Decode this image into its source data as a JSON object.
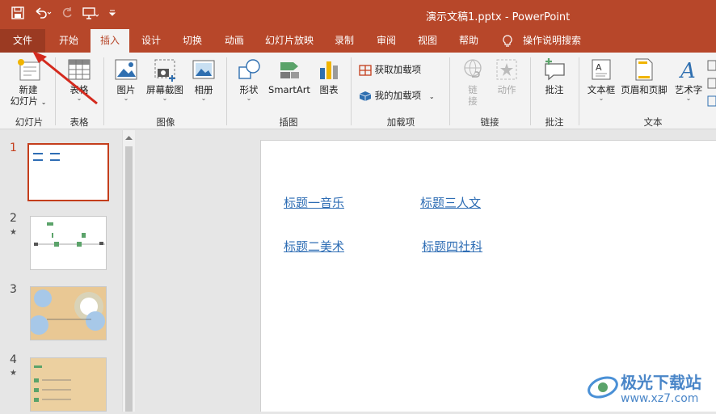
{
  "titlebar": {
    "title": "演示文稿1.pptx  -  PowerPoint",
    "qat": {
      "save_icon": "save-icon",
      "undo_icon": "undo-icon",
      "redo_icon": "redo-icon",
      "present_icon": "present-icon",
      "customize_icon": "dropdown-icon"
    }
  },
  "tabs": [
    {
      "label": "文件"
    },
    {
      "label": "开始"
    },
    {
      "label": "插入"
    },
    {
      "label": "设计"
    },
    {
      "label": "切换"
    },
    {
      "label": "动画"
    },
    {
      "label": "幻灯片放映"
    },
    {
      "label": "录制"
    },
    {
      "label": "审阅"
    },
    {
      "label": "视图"
    },
    {
      "label": "帮助"
    },
    {
      "label": "操作说明搜索"
    }
  ],
  "ribbon": {
    "new_slide": "新建\n幻灯片",
    "new_slide_l1": "新建",
    "new_slide_l2": "幻灯片",
    "table": "表格",
    "picture": "图片",
    "screenshot": "屏幕截图",
    "album": "相册",
    "shape": "形状",
    "smartart": "SmartArt",
    "chart": "图表",
    "get_addins": "获取加载项",
    "my_addins": "我的加载项",
    "link_l1": "链",
    "link_l2": "接",
    "action": "动作",
    "comment": "批注",
    "textbox": "文本框",
    "header_footer": "页眉和页脚",
    "wordart": "艺术字",
    "groups": {
      "slides": "幻灯片",
      "tables": "表格",
      "images": "图像",
      "illustrations": "插图",
      "addins": "加载项",
      "links": "链接",
      "comments": "批注",
      "text": "文本"
    }
  },
  "thumbnails": [
    {
      "num": "1",
      "star": ""
    },
    {
      "num": "2",
      "star": "★"
    },
    {
      "num": "3",
      "star": ""
    },
    {
      "num": "4",
      "star": "★"
    }
  ],
  "slide": {
    "links": [
      "标题一音乐",
      "标题三人文",
      "标题二美术",
      "标题四社科"
    ]
  },
  "watermark": {
    "text1": "极光下载站",
    "text2": "www.xz7.com"
  },
  "colors": {
    "accent": "#b7472a",
    "file_tab": "#9b3a22",
    "link": "#2e6db4",
    "selected_border": "#c43e1c"
  }
}
